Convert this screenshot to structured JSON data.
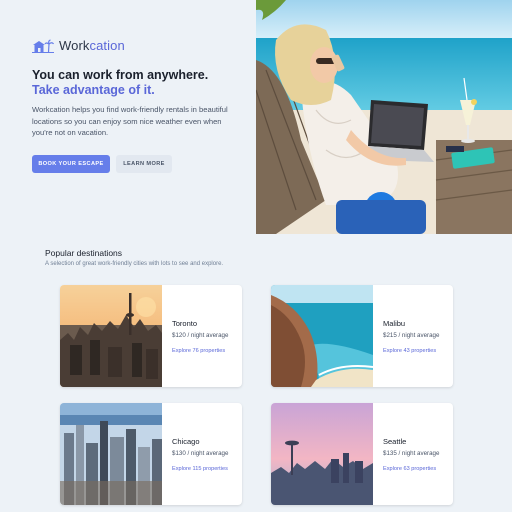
{
  "brand": {
    "name_prefix": "Work",
    "name_suffix": "cation",
    "accent": "#5a67d8"
  },
  "hero": {
    "title": "You can work from anywhere.",
    "subtitle": "Take advantage of it.",
    "description": "Workcation helps you find work-friendly rentals in beautiful locations so you can enjoy som nice weather even when you're not on vacation.",
    "primary_button": "Book your escape",
    "secondary_button": "Learn more"
  },
  "destinations": {
    "title": "Popular destinations",
    "subtitle": "A selection of great work-friendly cities with lots to see and explore.",
    "items": [
      {
        "city": "Toronto",
        "price": "$120 / night average",
        "link": "Explore 76 properties"
      },
      {
        "city": "Malibu",
        "price": "$215 / night average",
        "link": "Explore 43 properties"
      },
      {
        "city": "Chicago",
        "price": "$130 / night average",
        "link": "Explore 115 properties"
      },
      {
        "city": "Seattle",
        "price": "$135 / night average",
        "link": "Explore 63 properties"
      }
    ]
  },
  "colors": {
    "primary": "#667eea",
    "background": "#edf2f7",
    "secondary_button": "#e2e8f0"
  }
}
